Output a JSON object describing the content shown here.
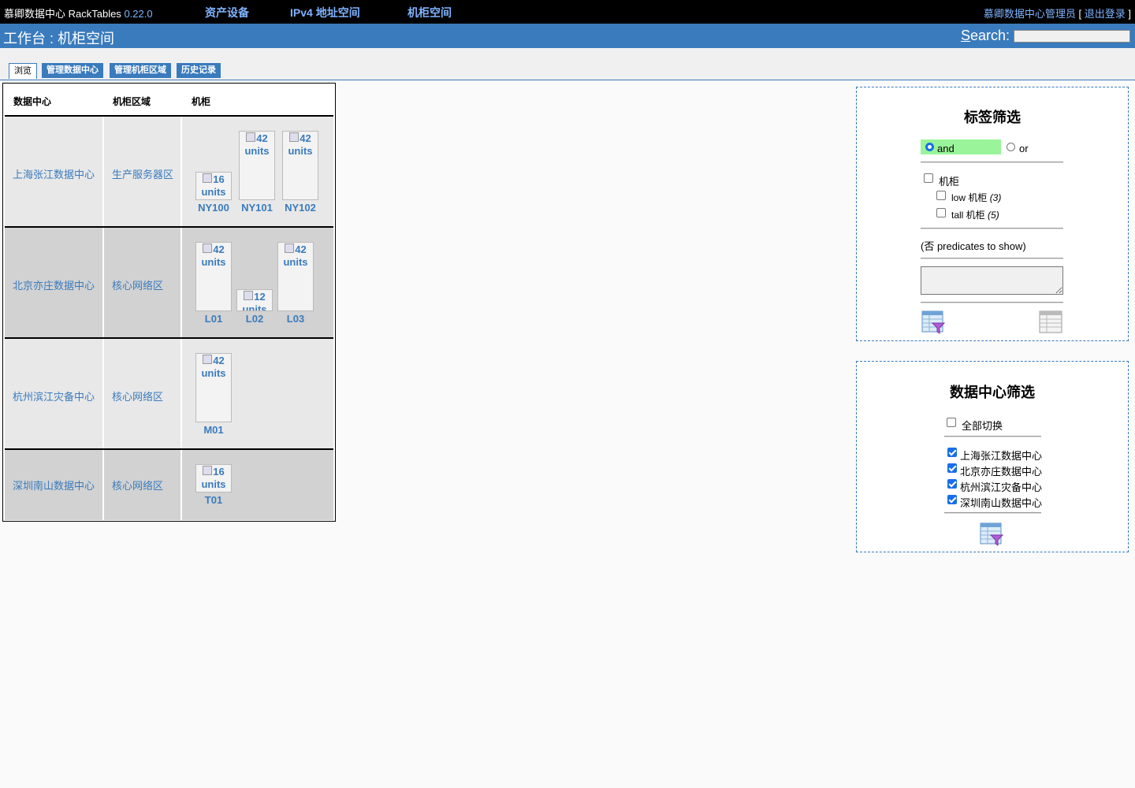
{
  "topbar": {
    "brand": "慕卿数据中心 RackTables",
    "version": "0.22.0",
    "nav": [
      "资产设备",
      "IPv4 地址空间",
      "机柜空间"
    ],
    "user": "慕卿数据中心管理员",
    "bracket_open": "[",
    "logout": "退出登录",
    "bracket_close": "]"
  },
  "titlebar": {
    "title": "工作台 : 机柜空间",
    "search_label_first": "S",
    "search_label_rest": "earch:"
  },
  "tabs": [
    "浏览",
    "管理数据中心",
    "管理机柜区域",
    "历史记录"
  ],
  "table": {
    "headers": [
      "数据中心",
      "机柜区域",
      "机柜"
    ],
    "rows": [
      {
        "datacenter": "上海张江数据中心",
        "area": "生产服务器区",
        "racks": [
          {
            "units": "16",
            "unit_label": "units",
            "name": "NY100"
          },
          {
            "units": "42",
            "unit_label": "units",
            "name": "NY101"
          },
          {
            "units": "42",
            "unit_label": "units",
            "name": "NY102"
          }
        ]
      },
      {
        "datacenter": "北京亦庄数据中心",
        "area": "核心网络区",
        "racks": [
          {
            "units": "42",
            "unit_label": "units",
            "name": "L01"
          },
          {
            "units": "12",
            "unit_label": "units",
            "name": "L02"
          },
          {
            "units": "42",
            "unit_label": "units",
            "name": "L03"
          }
        ]
      },
      {
        "datacenter": "杭州滨江灾备中心",
        "area": "核心网络区",
        "racks": [
          {
            "units": "42",
            "unit_label": "units",
            "name": "M01"
          }
        ]
      },
      {
        "datacenter": "深圳南山数据中心",
        "area": "核心网络区",
        "racks": [
          {
            "units": "16",
            "unit_label": "units",
            "name": "T01"
          }
        ]
      }
    ]
  },
  "tag_filter": {
    "title": "标签筛选",
    "and_label": "and",
    "or_label": "or",
    "selected_mode": "and",
    "root_tag": "机柜",
    "tags": [
      {
        "label": "low 机柜",
        "count": "(3)"
      },
      {
        "label": "tall 机柜",
        "count": "(5)"
      }
    ],
    "predicates_note": "(否 predicates to show)",
    "apply_icon": "filter-apply-icon",
    "reset_icon": "table-reset-icon"
  },
  "dc_filter": {
    "title": "数据中心筛选",
    "toggle_all": "全部切换",
    "items": [
      {
        "label": "上海张江数据中心",
        "checked": true
      },
      {
        "label": "北京亦庄数据中心",
        "checked": true
      },
      {
        "label": "杭州滨江灾备中心",
        "checked": true
      },
      {
        "label": "深圳南山数据中心",
        "checked": true
      }
    ],
    "apply_icon": "filter-apply-icon"
  }
}
